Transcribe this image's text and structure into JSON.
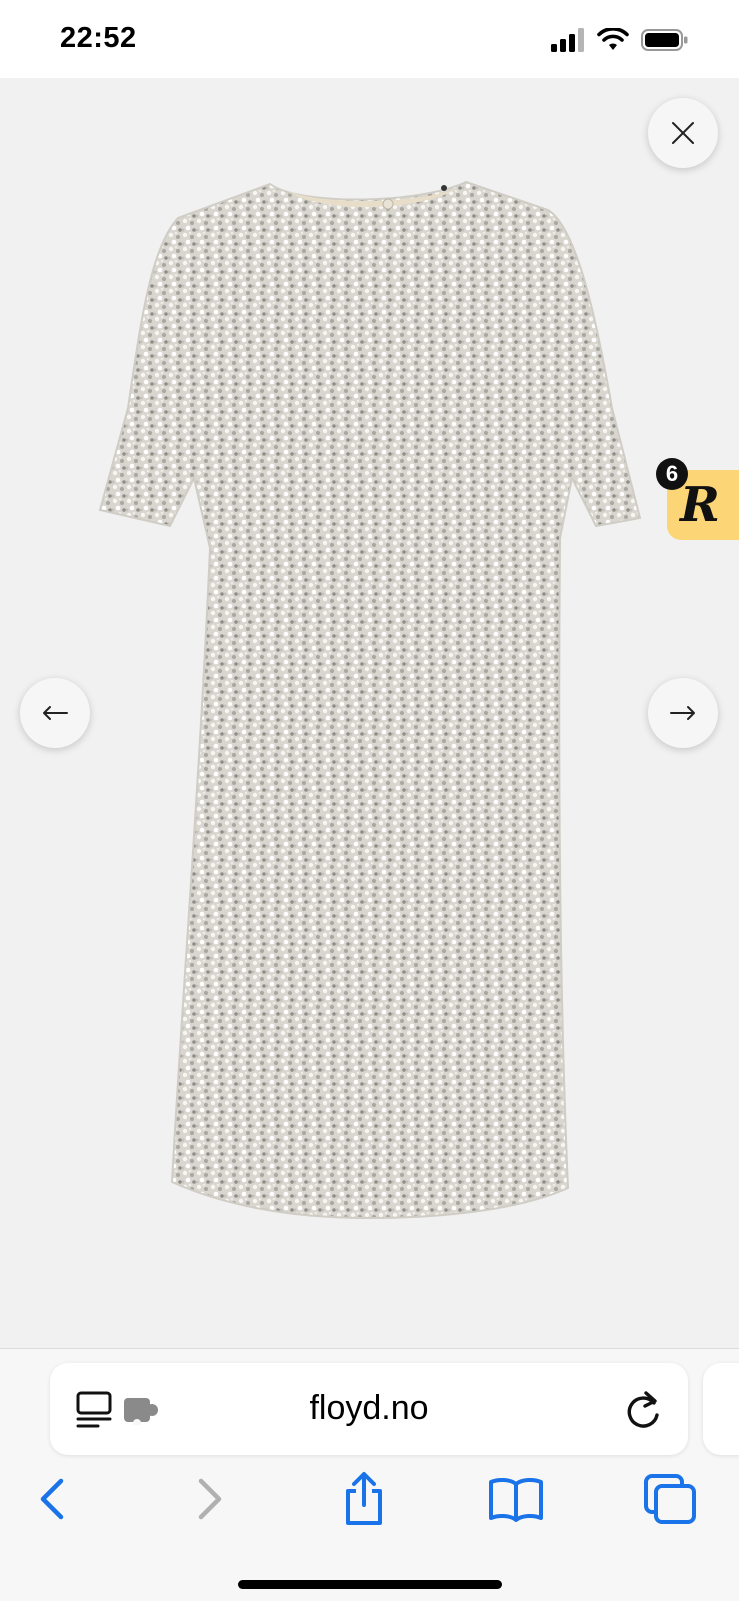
{
  "status_bar": {
    "time": "22:52",
    "icons": [
      "signal-icon",
      "wifi-icon",
      "battery-icon"
    ]
  },
  "viewer": {
    "image": "sequin-dress-image",
    "controls": {
      "close": "close-icon",
      "previous": "arrow-left-icon",
      "next": "arrow-right-icon"
    },
    "reward_widget": {
      "badge_count": "6",
      "logo_letter": "R",
      "color": "#fcd577"
    }
  },
  "browser": {
    "url": "floyd.no",
    "icons": [
      "reader-icon",
      "extension-icon",
      "reload-icon"
    ],
    "toolbar": [
      "back-icon",
      "forward-icon",
      "share-icon",
      "bookmarks-icon",
      "tabs-icon"
    ],
    "accent_color": "#1a73e8"
  }
}
